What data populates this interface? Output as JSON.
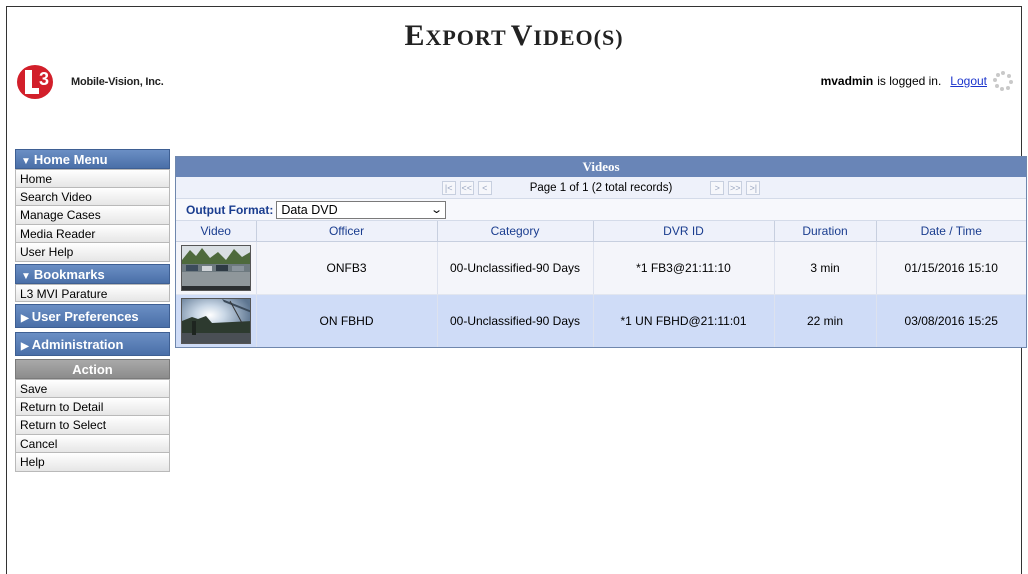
{
  "page_title": {
    "first_big": "E",
    "first_rest": "XPORT",
    "second_big": "V",
    "second_rest": "IDEO(S)"
  },
  "logo": {
    "mark": "L3",
    "name": "Mobile-Vision, Inc."
  },
  "user_bar": {
    "username": "mvadmin",
    "status": "is logged in.",
    "logout": "Logout"
  },
  "sidebar": {
    "home_menu": {
      "title": "Home Menu",
      "items": [
        "Home",
        "Search Video",
        "Manage Cases",
        "Media Reader",
        "User Help"
      ]
    },
    "bookmarks": {
      "title": "Bookmarks",
      "items": [
        "L3 MVI Parature"
      ]
    },
    "user_preferences": {
      "title": "User Preferences"
    },
    "administration": {
      "title": "Administration"
    },
    "action": {
      "title": "Action",
      "items": [
        "Save",
        "Return to Detail",
        "Return to Select",
        "Cancel",
        "Help"
      ]
    }
  },
  "videos_panel": {
    "title": "Videos",
    "pager": {
      "text": "Page 1 of 1 (2 total records)",
      "first": "|<",
      "prev_page": "<<",
      "prev": "<",
      "next": ">",
      "next_page": ">>",
      "last": ">|"
    },
    "output_format": {
      "label": "Output Format:",
      "value": "Data DVD"
    },
    "columns": [
      "Video",
      "Officer",
      "Category",
      "DVR ID",
      "Duration",
      "Date / Time"
    ],
    "rows": [
      {
        "officer": "ONFB3",
        "category": "00-Unclassified-90 Days",
        "dvr_id": "*1 FB3@21:11:10",
        "duration": "3 min",
        "datetime": "01/15/2016 15:10",
        "thumb_icon": "parking-lot-thumbnail"
      },
      {
        "officer": "ON FBHD",
        "category": "00-Unclassified-90 Days",
        "dvr_id": "*1 UN FBHD@21:11:01",
        "duration": "22 min",
        "datetime": "03/08/2016 15:25",
        "thumb_icon": "sunset-road-thumbnail"
      }
    ]
  },
  "colors": {
    "accent": "#6985b7",
    "link": "#1a33cc",
    "header_text": "#1a3d8f",
    "selected_row": "#cfdcf7",
    "logo_red": "#d21f2a"
  }
}
